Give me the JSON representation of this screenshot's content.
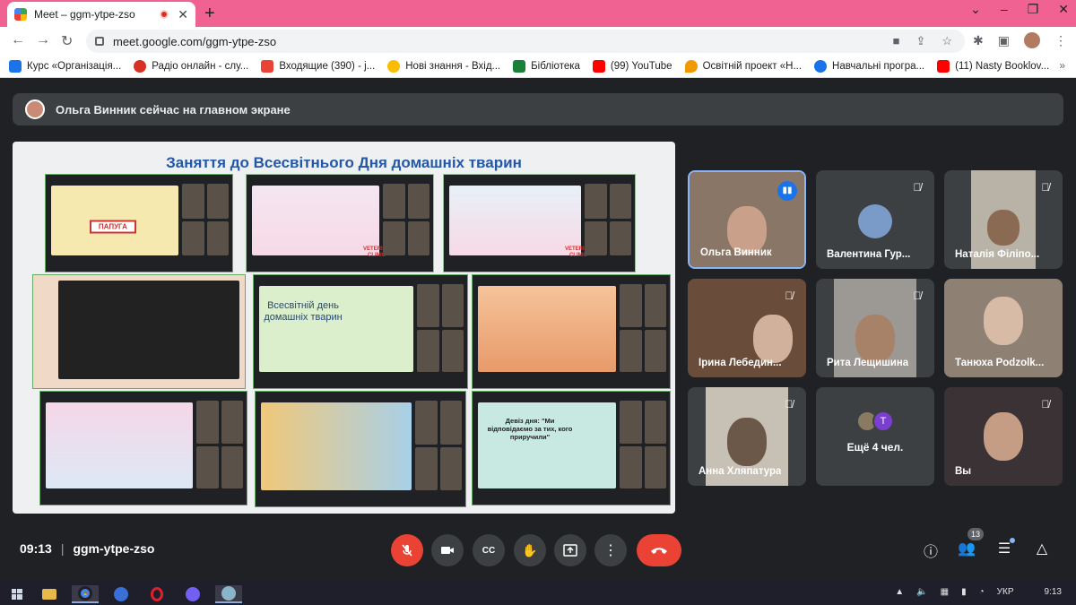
{
  "browser": {
    "tab_title": "Meet – ggm-ytpe-zso",
    "url": "meet.google.com/ggm-ytpe-zso",
    "new_tab": "+",
    "window_controls": [
      "⌄",
      "–",
      "❐",
      "✕"
    ]
  },
  "bookmarks": [
    {
      "label": "Курс «Організація...",
      "icon": "snowflake-icon",
      "color": "#1a73e8"
    },
    {
      "label": "Радіо онлайн - слу...",
      "icon": "radio-icon",
      "color": "#d93025"
    },
    {
      "label": "Входящие (390) - j...",
      "icon": "gmail-icon",
      "color": "#ea4335"
    },
    {
      "label": "Нові знання - Вхід...",
      "icon": "sun-icon",
      "color": "#fbbc04"
    },
    {
      "label": "Бібліотека",
      "icon": "classroom-icon",
      "color": "#188038"
    },
    {
      "label": "(99) YouTube",
      "icon": "youtube-icon",
      "color": "#ff0000"
    },
    {
      "label": "Освітній проект «Н...",
      "icon": "drop-icon",
      "color": "#f29900"
    },
    {
      "label": "Навчальні програ...",
      "icon": "oc-icon",
      "color": "#1a73e8"
    },
    {
      "label": "(11) Nasty Booklov...",
      "icon": "youtube-icon",
      "color": "#ff0000"
    }
  ],
  "bookmarks_more": "»",
  "presenter_text": "Ольга Винник сейчас на главном экране",
  "slide": {
    "title": "Заняття до Всесвітнього Дня домашніх тварин",
    "thumb_texts": {
      "parrot": "ПАПУГА",
      "world_day": "Всесвітній день домашніх тварин",
      "motto": "Девіз дня: \"Ми відповідаємо за тих, кого приручили\"",
      "clinic": "VETERINARY CLINIC"
    }
  },
  "participants": [
    {
      "name": "Ольга Винник",
      "status": "speaking",
      "active": true,
      "bg": "#8a7666",
      "face": "#c9a08a"
    },
    {
      "name": "Валентина Гур...",
      "status": "muted",
      "avatar": true,
      "bg": "#3c4043",
      "face": "#7a9bc7"
    },
    {
      "name": "Наталія Філіпо...",
      "status": "muted",
      "bg": "#b9b2a6",
      "face": "#8a6a52"
    },
    {
      "name": "Ірина Лебедин...",
      "status": "muted",
      "bg": "#6a4c3a",
      "face": "#d2b19c"
    },
    {
      "name": "Рита Лещишина",
      "status": "muted",
      "bg": "#9c9894",
      "face": "#a88268"
    },
    {
      "name": "Танюха Podzolk...",
      "status": "none",
      "bg": "#8f8074",
      "face": "#d8bba6"
    },
    {
      "name": "Анна Хляпатура",
      "status": "muted",
      "bg": "#c7c0b4",
      "face": "#6c5848"
    },
    {
      "name": "Ещё 4 чел.",
      "status": "more",
      "avatar_letter": "T"
    },
    {
      "name": "Вы",
      "status": "muted",
      "bg": "#3b3236",
      "face": "#c59c84"
    }
  ],
  "footer": {
    "time": "09:13",
    "separator": "|",
    "meeting_code": "ggm-ytpe-zso",
    "people_count": "13"
  },
  "controls": {
    "mic": "mic-off-icon",
    "camera": "camera-icon",
    "captions": "CC",
    "hand": "hand-icon",
    "present": "present-icon",
    "more": "⋮",
    "end": "end-call-icon"
  },
  "taskbar": {
    "lang": "УКР",
    "clock": "9:13",
    "tray_arrow": "▲"
  }
}
